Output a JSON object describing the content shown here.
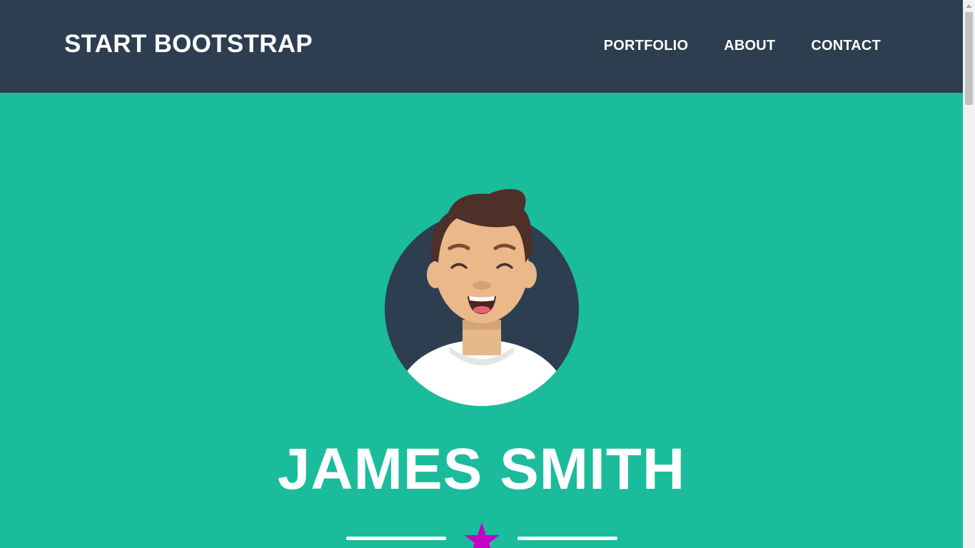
{
  "navbar": {
    "brand": "START BOOTSTRAP",
    "links": [
      {
        "label": "PORTFOLIO"
      },
      {
        "label": "ABOUT"
      },
      {
        "label": "CONTACT"
      }
    ]
  },
  "hero": {
    "name": "JAMES SMITH",
    "divider_icon": "star-icon"
  },
  "colors": {
    "navbar_bg": "#2c3e50",
    "hero_bg": "#1abc9c",
    "text": "#ffffff",
    "star": "#c700c7"
  }
}
